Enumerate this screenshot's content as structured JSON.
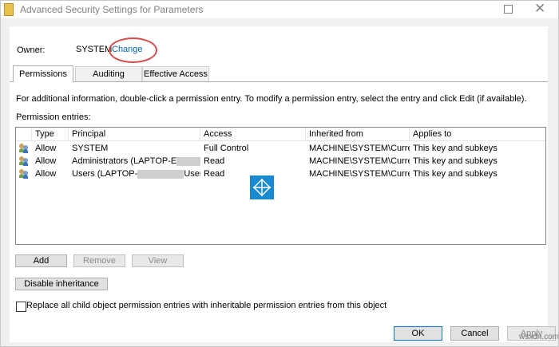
{
  "window": {
    "title": "Advanced Security Settings for Parameters"
  },
  "owner": {
    "label": "Owner:",
    "value": "SYSTEM",
    "change_link": "Change"
  },
  "tabs": [
    {
      "label": "Permissions",
      "active": true
    },
    {
      "label": "Auditing",
      "active": false
    },
    {
      "label": "Effective Access",
      "active": false
    }
  ],
  "info_text": "For additional information, double-click a permission entry. To modify a permission entry, select the entry and click Edit (if available).",
  "entries_label": "Permission entries:",
  "table": {
    "columns": [
      "Type",
      "Principal",
      "Access",
      "Inherited from",
      "Applies to"
    ],
    "rows": [
      {
        "type": "Allow",
        "principal": "SYSTEM",
        "access": "Full Control",
        "inherited_from": "MACHINE\\SYSTEM\\Curre...",
        "applies_to": "This key and subkeys"
      },
      {
        "type": "Allow",
        "principal": "Administrators (LAPTOP-E",
        "access": "Read",
        "inherited_from": "MACHINE\\SYSTEM\\Curre...",
        "applies_to": "This key and subkeys"
      },
      {
        "type": "Allow",
        "principal_prefix": "Users (LAPTOP-",
        "principal_suffix": "Users)",
        "access": "Read",
        "inherited_from": "MACHINE\\SYSTEM\\Curre...",
        "applies_to": "This key and subkeys"
      }
    ]
  },
  "buttons": {
    "add": "Add",
    "remove": "Remove",
    "view": "View",
    "disable_inheritance": "Disable inheritance"
  },
  "replace_checkbox": {
    "label": "Replace all child object permission entries with inheritable permission entries from this object",
    "checked": false
  },
  "footer": {
    "ok": "OK",
    "cancel": "Cancel",
    "apply": "Apply"
  },
  "watermark": "wsxdn.com",
  "colors": {
    "link": "#0063b1",
    "highlight_circle": "#d94b4b"
  },
  "icons": [
    "folder-icon",
    "users-icon",
    "windows-logo-icon"
  ]
}
